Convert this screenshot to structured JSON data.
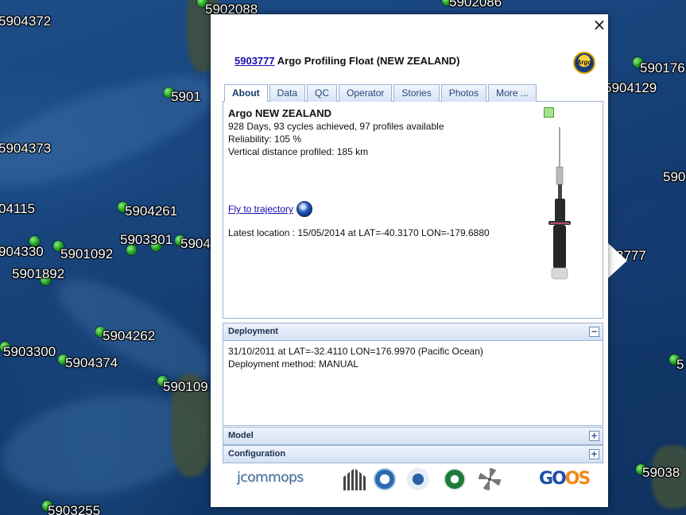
{
  "map": {
    "float_labels": [
      "5904372",
      "5902088",
      "5902086",
      "590176",
      "5901",
      "5904129",
      "5904373",
      "590",
      "04115",
      "5904261",
      "5903301",
      "5904",
      "904330",
      "5901092",
      "5901892",
      "3777",
      "5904262",
      "5903300",
      "5904374",
      "590109",
      "5",
      "5903255",
      "59038"
    ]
  },
  "balloon": {
    "close_label": "×",
    "title_link": "5903777",
    "title_text": " Argo Profiling Float (NEW ZEALAND)",
    "logo_label": "Argo",
    "tabs": [
      {
        "label": "About",
        "active": true
      },
      {
        "label": "Data",
        "active": false
      },
      {
        "label": "QC",
        "active": false
      },
      {
        "label": "Operator",
        "active": false
      },
      {
        "label": "Stories",
        "active": false
      },
      {
        "label": "Photos",
        "active": false
      },
      {
        "label": "More ...",
        "active": false
      }
    ],
    "about": {
      "heading": "Argo NEW ZEALAND",
      "line1": "928 Days, 93 cycles achieved, 97 profiles available",
      "line2": "Reliability: 105 %",
      "line3": "Vertical distance profiled: 185 km",
      "fly_link": "Fly to trajectory",
      "latest_location": "Latest location : 15/05/2014 at LAT=-40.3170 LON=-179.6880",
      "status_color": "#a6e38e"
    },
    "deployment": {
      "header": "Deployment",
      "toggle": "−",
      "line1": "31/10/2011 at LAT=-32.4110 LON=176.9970 (Pacific Ocean)",
      "line2": "Deployment method: MANUAL"
    },
    "model": {
      "header": "Model",
      "toggle": "+"
    },
    "configuration": {
      "header": "Configuration",
      "toggle": "+"
    },
    "footer": {
      "jcommops": "jcommops",
      "goos_g": "G",
      "goos_o1": "O",
      "goos_o2": "O",
      "goos_s": "S"
    }
  }
}
